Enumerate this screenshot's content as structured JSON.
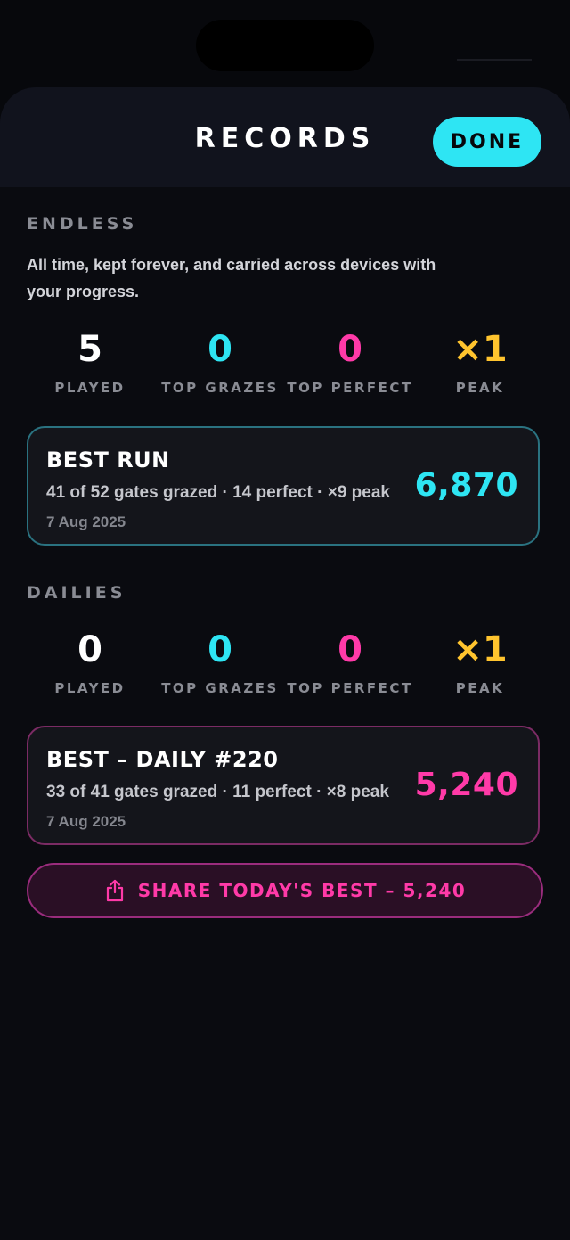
{
  "colors": {
    "cyan": "#2ee5f3",
    "pink": "#ff3aa8",
    "gold": "#ffc42e",
    "white": "#ffffff"
  },
  "header": {
    "title": "RECORDS",
    "done_label": "DONE"
  },
  "endless": {
    "label": "ENDLESS",
    "description": "All time, kept forever, and carried across devices with your progress.",
    "stats": [
      {
        "value": "5",
        "label": "PLAYED",
        "color": "#ffffff"
      },
      {
        "value": "0",
        "label": "TOP GRAZES",
        "color": "#2ee5f3"
      },
      {
        "value": "0",
        "label": "TOP PERFECT",
        "color": "#ff3aa8"
      },
      {
        "value": "×1",
        "label": "PEAK",
        "color": "#ffc42e"
      }
    ],
    "best": {
      "title": "BEST RUN",
      "details": "41 of 52 gates grazed · 14 perfect · ×9 peak",
      "date": "7 Aug 2025",
      "score": "6,870"
    }
  },
  "dailies": {
    "label": "DAILIES",
    "stats": [
      {
        "value": "0",
        "label": "PLAYED",
        "color": "#ffffff"
      },
      {
        "value": "0",
        "label": "TOP GRAZES",
        "color": "#2ee5f3"
      },
      {
        "value": "0",
        "label": "TOP PERFECT",
        "color": "#ff3aa8"
      },
      {
        "value": "×1",
        "label": "PEAK",
        "color": "#ffc42e"
      }
    ],
    "best": {
      "title": "BEST – DAILY #220",
      "details": "33 of 41 gates grazed · 11 perfect · ×8 peak",
      "date": "7 Aug 2025",
      "score": "5,240"
    },
    "share_label": "SHARE TODAY'S BEST – 5,240",
    "share_icon": "share-icon"
  }
}
